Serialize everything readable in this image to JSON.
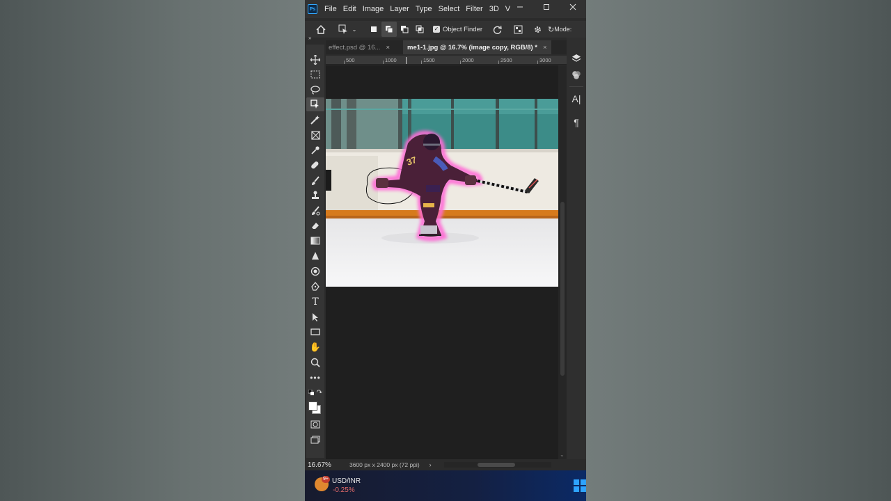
{
  "app": {
    "logo": "Ps"
  },
  "menubar": {
    "items": [
      "File",
      "Edit",
      "Image",
      "Layer",
      "Type",
      "Select",
      "Filter",
      "3D",
      "V"
    ],
    "window_buttons": [
      "minimize-icon",
      "maximize-icon",
      "close-icon"
    ]
  },
  "options_bar": {
    "object_finder_label": "Object Finder",
    "object_finder_checked": true,
    "mode_label": "Mode:"
  },
  "tabs": [
    {
      "label": "effect.psd @ 16...",
      "active": false,
      "close": "×"
    },
    {
      "label": "me1-1.jpg @ 16.7% (image copy, RGB/8) *",
      "active": true,
      "close": "×"
    }
  ],
  "ruler": {
    "ticks": [
      "500",
      "1000",
      "1500",
      "2000",
      "2500",
      "3000"
    ]
  },
  "toolbar": {
    "tools": [
      "move-icon",
      "marquee-icon",
      "lasso-icon",
      "object-selection-icon",
      "magic-wand-icon",
      "frame-icon",
      "eyedropper-icon",
      "healing-brush-icon",
      "brush-icon",
      "clone-stamp-icon",
      "history-brush-icon",
      "eraser-icon",
      "gradient-icon",
      "blur-icon",
      "dodge-icon",
      "pen-icon",
      "type-icon",
      "path-selection-icon",
      "rectangle-icon",
      "hand-icon",
      "zoom-icon",
      "more-tools-icon"
    ],
    "selected": "object-selection-icon"
  },
  "status": {
    "zoom": "16.67%",
    "doc_info": "3600 px x 2400 px (72 ppi)",
    "arrow": "›"
  },
  "taskbar": {
    "ticker_name": "USD/INR",
    "ticker_change": "-0.25%",
    "badge": "9+"
  },
  "colors": {
    "selection_glow": "#ff6ad5",
    "ps_blue": "#31a8ff",
    "rink_board": "#2f8a88"
  }
}
